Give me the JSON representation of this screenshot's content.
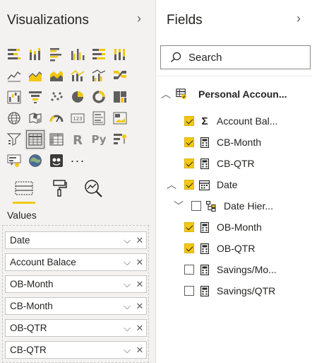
{
  "visualizations": {
    "title": "Visualizations",
    "chevron": "›",
    "icons": [
      "stacked-bar-chart-icon",
      "stacked-column-chart-icon",
      "clustered-bar-chart-icon",
      "clustered-column-chart-icon",
      "100-percent-stacked-bar-icon",
      "100-percent-stacked-column-icon",
      "",
      "line-chart-icon",
      "area-chart-icon",
      "stacked-area-chart-icon",
      "line-and-stacked-column-icon",
      "line-and-clustered-column-icon",
      "ribbon-chart-icon",
      "",
      "waterfall-chart-icon",
      "funnel-icon",
      "scatter-chart-icon",
      "pie-chart-icon",
      "donut-chart-icon",
      "treemap-icon",
      "",
      "map-icon",
      "filled-map-icon",
      "gauge-icon",
      "card-icon",
      "multi-row-card-icon",
      "kpi-icon",
      "",
      "slicer-icon",
      "table-icon",
      "matrix-icon",
      "r-script-icon",
      "python-icon",
      "key-influencers-icon",
      "",
      "decomposition-tree-icon",
      "arcgis-map-icon",
      "custom-visual-icon",
      "more-icon",
      "",
      "",
      ""
    ],
    "tools": [
      "fields-tool-icon",
      "format-tool-icon",
      "analytics-tool-icon"
    ],
    "values_label": "Values",
    "wells": [
      {
        "label": "Date"
      },
      {
        "label": "Account Balace"
      },
      {
        "label": "OB-Month"
      },
      {
        "label": "CB-Month"
      },
      {
        "label": "OB-QTR"
      },
      {
        "label": "CB-QTR"
      }
    ],
    "well_icons": {
      "expand": "chevron-down-icon",
      "remove": "close-icon"
    }
  },
  "fields": {
    "title": "Fields",
    "chevron": "›",
    "search_placeholder": "Search",
    "table": {
      "label": "Personal Accoun...",
      "expanded": true
    },
    "items": [
      {
        "label": "Account Bal...",
        "icon": "sigma-icon",
        "checked": true
      },
      {
        "label": "CB-Month",
        "icon": "calculator-icon",
        "checked": true
      },
      {
        "label": "CB-QTR",
        "icon": "calculator-icon",
        "checked": true
      },
      {
        "label": "Date",
        "icon": "calendar-icon",
        "checked": true,
        "expanded": true
      },
      {
        "label": "Date Hier...",
        "icon": "hierarchy-icon",
        "checked": false,
        "expanded": true
      },
      {
        "label": "OB-Month",
        "icon": "calculator-icon",
        "checked": true
      },
      {
        "label": "OB-QTR",
        "icon": "calculator-icon",
        "checked": true
      },
      {
        "label": "Savings/Mo...",
        "icon": "calculator-icon",
        "checked": false
      },
      {
        "label": "Savings/QTR",
        "icon": "calculator-icon",
        "checked": false
      }
    ]
  },
  "colors": {
    "accent": "#f2c811",
    "pane_bg": "#f3f2f1",
    "text": "#252423"
  }
}
